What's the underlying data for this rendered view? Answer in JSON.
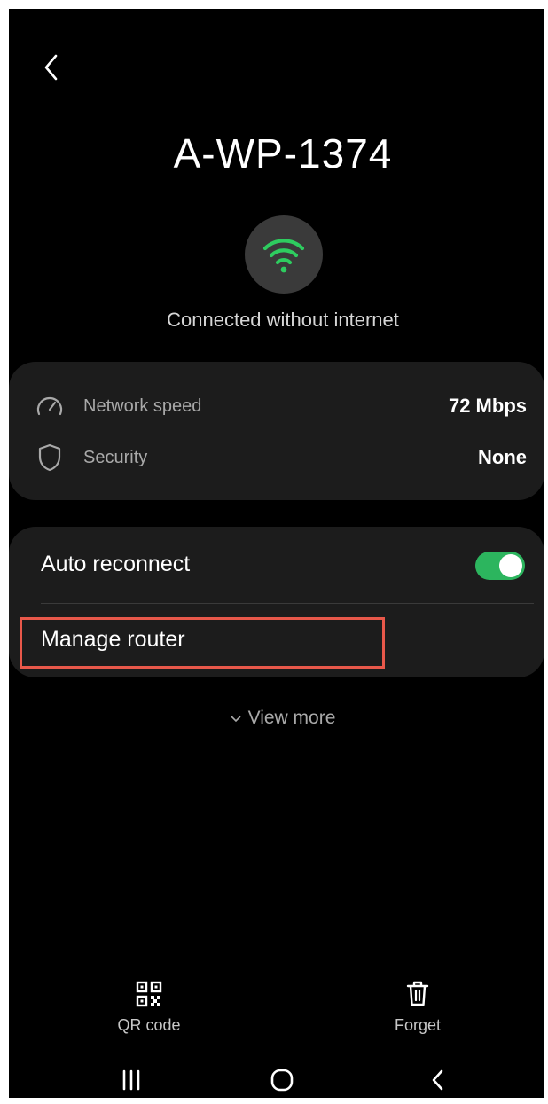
{
  "header": {
    "back_icon": "chevron-left-icon",
    "network_name": "A-WP-1374"
  },
  "connection": {
    "icon": "wifi-icon",
    "icon_color": "#2ecc5f",
    "status": "Connected without internet"
  },
  "info": {
    "network_speed": {
      "icon": "speedometer-icon",
      "label": "Network speed",
      "value": "72 Mbps"
    },
    "security": {
      "icon": "shield-icon",
      "label": "Security",
      "value": "None"
    }
  },
  "settings": {
    "auto_reconnect": {
      "label": "Auto reconnect",
      "enabled": true,
      "toggle_color": "#2cb55e"
    },
    "manage_router": {
      "label": "Manage router",
      "highlight_color": "#e8584a"
    }
  },
  "view_more": {
    "label": "View more"
  },
  "actions": {
    "qr_code": {
      "icon": "qr-code-icon",
      "label": "QR code"
    },
    "forget": {
      "icon": "trash-icon",
      "label": "Forget"
    }
  },
  "navbar": {
    "recents_icon": "recents-icon",
    "home_icon": "home-icon",
    "back_icon": "back-icon"
  }
}
